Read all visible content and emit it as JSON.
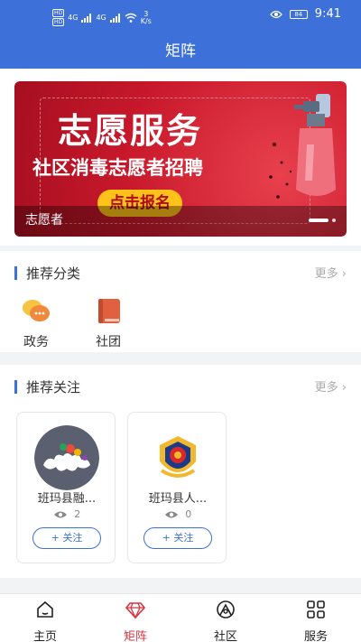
{
  "status_bar": {
    "hd1": "HD",
    "hd2": "HD",
    "net1": "4G",
    "net2": "4G",
    "speed_value": "3",
    "speed_unit": "K/s",
    "battery": "84",
    "time": "9:41"
  },
  "header": {
    "title": "矩阵"
  },
  "banner": {
    "title": "志愿服务",
    "subtitle": "社区消毒志愿者招聘",
    "button_label": "点击报名",
    "caption": "志愿者",
    "slide_count": 2,
    "active_slide": 1
  },
  "recommended_categories": {
    "title": "推荐分类",
    "more_label": "更多",
    "items": [
      {
        "label": "政务",
        "icon": "chat-bubbles-icon"
      },
      {
        "label": "社团",
        "icon": "book-icon"
      }
    ]
  },
  "recommended_follows": {
    "title": "推荐关注",
    "more_label": "更多",
    "items": [
      {
        "name": "班玛县融...",
        "views": "2",
        "follow_label": "+  关注",
        "logo": "cloud-emblem-logo"
      },
      {
        "name": "班玛县人...",
        "views": "0",
        "follow_label": "+  关注",
        "logo": "police-emblem-logo"
      }
    ]
  },
  "tab_bar": {
    "active": "矩阵",
    "tabs": [
      {
        "label": "主页",
        "icon": "home-icon"
      },
      {
        "label": "矩阵",
        "icon": "diamond-icon"
      },
      {
        "label": "社区",
        "icon": "community-icon"
      },
      {
        "label": "服务",
        "icon": "grid-icon"
      }
    ]
  },
  "colors": {
    "header_bg": "#3d70d8",
    "accent_blue": "#3d70d8",
    "active_tab": "#d7343f",
    "banner_red": "#c8182b",
    "button_yellow": "#ffc21a"
  }
}
